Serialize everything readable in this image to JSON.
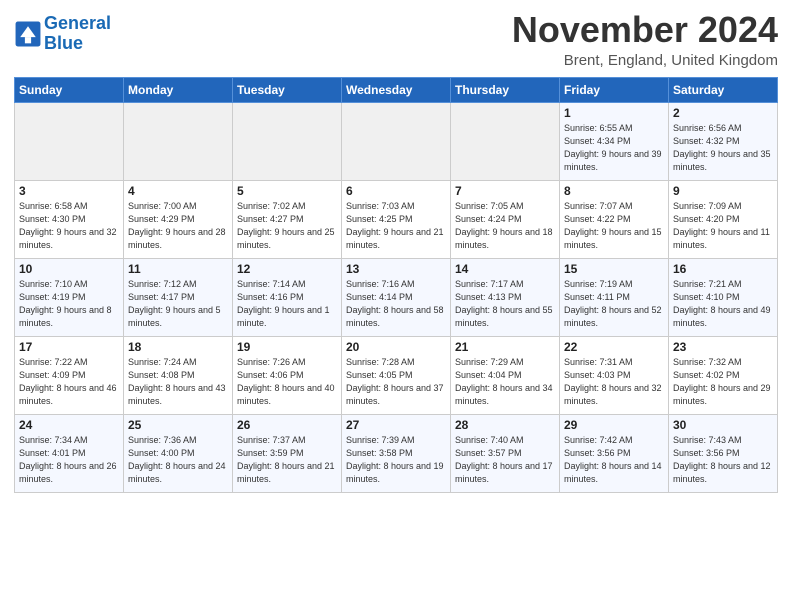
{
  "header": {
    "logo_line1": "General",
    "logo_line2": "Blue",
    "month": "November 2024",
    "location": "Brent, England, United Kingdom"
  },
  "days_of_week": [
    "Sunday",
    "Monday",
    "Tuesday",
    "Wednesday",
    "Thursday",
    "Friday",
    "Saturday"
  ],
  "weeks": [
    [
      {
        "day": "",
        "info": ""
      },
      {
        "day": "",
        "info": ""
      },
      {
        "day": "",
        "info": ""
      },
      {
        "day": "",
        "info": ""
      },
      {
        "day": "",
        "info": ""
      },
      {
        "day": "1",
        "info": "Sunrise: 6:55 AM\nSunset: 4:34 PM\nDaylight: 9 hours and 39 minutes."
      },
      {
        "day": "2",
        "info": "Sunrise: 6:56 AM\nSunset: 4:32 PM\nDaylight: 9 hours and 35 minutes."
      }
    ],
    [
      {
        "day": "3",
        "info": "Sunrise: 6:58 AM\nSunset: 4:30 PM\nDaylight: 9 hours and 32 minutes."
      },
      {
        "day": "4",
        "info": "Sunrise: 7:00 AM\nSunset: 4:29 PM\nDaylight: 9 hours and 28 minutes."
      },
      {
        "day": "5",
        "info": "Sunrise: 7:02 AM\nSunset: 4:27 PM\nDaylight: 9 hours and 25 minutes."
      },
      {
        "day": "6",
        "info": "Sunrise: 7:03 AM\nSunset: 4:25 PM\nDaylight: 9 hours and 21 minutes."
      },
      {
        "day": "7",
        "info": "Sunrise: 7:05 AM\nSunset: 4:24 PM\nDaylight: 9 hours and 18 minutes."
      },
      {
        "day": "8",
        "info": "Sunrise: 7:07 AM\nSunset: 4:22 PM\nDaylight: 9 hours and 15 minutes."
      },
      {
        "day": "9",
        "info": "Sunrise: 7:09 AM\nSunset: 4:20 PM\nDaylight: 9 hours and 11 minutes."
      }
    ],
    [
      {
        "day": "10",
        "info": "Sunrise: 7:10 AM\nSunset: 4:19 PM\nDaylight: 9 hours and 8 minutes."
      },
      {
        "day": "11",
        "info": "Sunrise: 7:12 AM\nSunset: 4:17 PM\nDaylight: 9 hours and 5 minutes."
      },
      {
        "day": "12",
        "info": "Sunrise: 7:14 AM\nSunset: 4:16 PM\nDaylight: 9 hours and 1 minute."
      },
      {
        "day": "13",
        "info": "Sunrise: 7:16 AM\nSunset: 4:14 PM\nDaylight: 8 hours and 58 minutes."
      },
      {
        "day": "14",
        "info": "Sunrise: 7:17 AM\nSunset: 4:13 PM\nDaylight: 8 hours and 55 minutes."
      },
      {
        "day": "15",
        "info": "Sunrise: 7:19 AM\nSunset: 4:11 PM\nDaylight: 8 hours and 52 minutes."
      },
      {
        "day": "16",
        "info": "Sunrise: 7:21 AM\nSunset: 4:10 PM\nDaylight: 8 hours and 49 minutes."
      }
    ],
    [
      {
        "day": "17",
        "info": "Sunrise: 7:22 AM\nSunset: 4:09 PM\nDaylight: 8 hours and 46 minutes."
      },
      {
        "day": "18",
        "info": "Sunrise: 7:24 AM\nSunset: 4:08 PM\nDaylight: 8 hours and 43 minutes."
      },
      {
        "day": "19",
        "info": "Sunrise: 7:26 AM\nSunset: 4:06 PM\nDaylight: 8 hours and 40 minutes."
      },
      {
        "day": "20",
        "info": "Sunrise: 7:28 AM\nSunset: 4:05 PM\nDaylight: 8 hours and 37 minutes."
      },
      {
        "day": "21",
        "info": "Sunrise: 7:29 AM\nSunset: 4:04 PM\nDaylight: 8 hours and 34 minutes."
      },
      {
        "day": "22",
        "info": "Sunrise: 7:31 AM\nSunset: 4:03 PM\nDaylight: 8 hours and 32 minutes."
      },
      {
        "day": "23",
        "info": "Sunrise: 7:32 AM\nSunset: 4:02 PM\nDaylight: 8 hours and 29 minutes."
      }
    ],
    [
      {
        "day": "24",
        "info": "Sunrise: 7:34 AM\nSunset: 4:01 PM\nDaylight: 8 hours and 26 minutes."
      },
      {
        "day": "25",
        "info": "Sunrise: 7:36 AM\nSunset: 4:00 PM\nDaylight: 8 hours and 24 minutes."
      },
      {
        "day": "26",
        "info": "Sunrise: 7:37 AM\nSunset: 3:59 PM\nDaylight: 8 hours and 21 minutes."
      },
      {
        "day": "27",
        "info": "Sunrise: 7:39 AM\nSunset: 3:58 PM\nDaylight: 8 hours and 19 minutes."
      },
      {
        "day": "28",
        "info": "Sunrise: 7:40 AM\nSunset: 3:57 PM\nDaylight: 8 hours and 17 minutes."
      },
      {
        "day": "29",
        "info": "Sunrise: 7:42 AM\nSunset: 3:56 PM\nDaylight: 8 hours and 14 minutes."
      },
      {
        "day": "30",
        "info": "Sunrise: 7:43 AM\nSunset: 3:56 PM\nDaylight: 8 hours and 12 minutes."
      }
    ]
  ]
}
